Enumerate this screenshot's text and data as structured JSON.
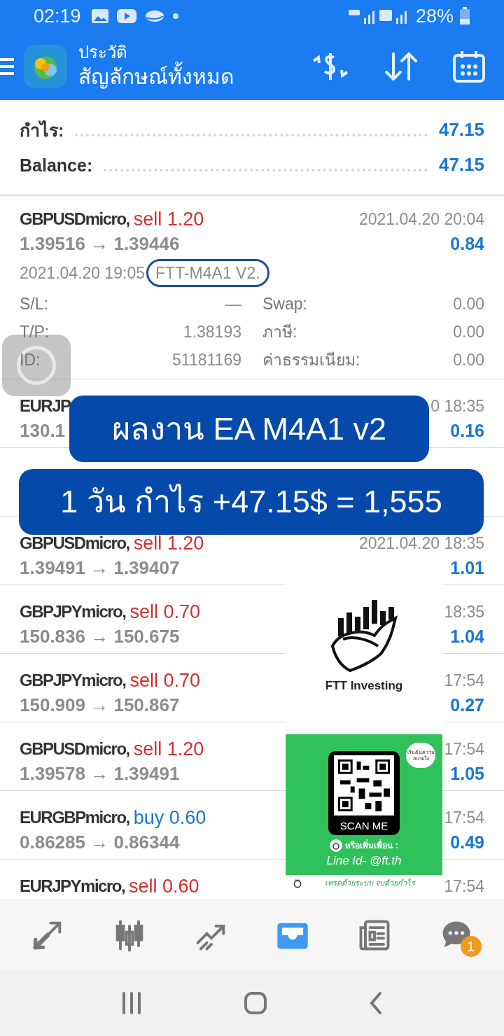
{
  "status_bar": {
    "time": "02:19",
    "battery": "28%"
  },
  "header": {
    "title": "ประวัติ",
    "subtitle": "สัญลักษณ์ทั้งหมด"
  },
  "summary": [
    {
      "label": "กำไร:",
      "value": "47.15"
    },
    {
      "label": "Balance:",
      "value": "47.15"
    }
  ],
  "trades": [
    {
      "symbol": "GBPUSDmicro,",
      "side": "sell 1.20",
      "kind": "sell",
      "prices": "1.39516 → 1.39446",
      "time": "2021.04.20 20:04",
      "profit": "0.84",
      "expanded": true,
      "open_time": "2021.04.20 19:05",
      "comment": "FTT-M4A1 V2.",
      "details": [
        {
          "label": "S/L:",
          "value": "—"
        },
        {
          "label": "Swap:",
          "value": "0.00"
        },
        {
          "label": "T/P:",
          "value": "1.38193"
        },
        {
          "label": "ภาษี:",
          "value": "0.00"
        },
        {
          "label": "ID:",
          "value": "51181169"
        },
        {
          "label": "ค่าธรรมเนียม:",
          "value": "0.00"
        }
      ]
    },
    {
      "symbol": "EURJP",
      "prices": "130.1",
      "time": "0 18:35",
      "profit": "0.16",
      "expanded": false
    },
    {
      "expanded": false
    },
    {
      "symbol": "GBPUSDmicro,",
      "side": "sell 1.20",
      "kind": "sell",
      "prices": "1.39491 → 1.39407",
      "time": "2021.04.20 18:35",
      "profit": "1.01",
      "expanded": false
    },
    {
      "symbol": "GBPJPYmicro,",
      "side": "sell 0.70",
      "kind": "sell",
      "prices": "150.836 → 150.675",
      "time": "18:35",
      "profit": "1.04",
      "expanded": false
    },
    {
      "symbol": "GBPJPYmicro,",
      "side": "sell 0.70",
      "kind": "sell",
      "prices": "150.909 → 150.867",
      "time": "17:54",
      "profit": "0.27",
      "expanded": false
    },
    {
      "symbol": "GBPUSDmicro,",
      "side": "sell 1.20",
      "kind": "sell",
      "prices": "1.39578 → 1.39491",
      "time": "17:54",
      "profit": "1.05",
      "expanded": false
    },
    {
      "symbol": "EURGBPmicro,",
      "side": "buy 0.60",
      "kind": "buy",
      "prices": "0.86285 → 0.86344",
      "time": "17:54",
      "profit": "0.49",
      "expanded": false
    },
    {
      "symbol": "EURJPYmicro,",
      "side": "sell 0.60",
      "kind": "sell",
      "time": "17:54",
      "expanded": false
    }
  ],
  "banners": [
    "ผลงาน EA M4A1 v2",
    "1 วัน กำไร +47.15$ = 1,555"
  ],
  "promo": {
    "brand": "FTT Investing",
    "bubble": "เริ่มต้นความสบายใจ",
    "scan": "SCAN ME",
    "add_friend": "หรือเพิ่มเพื่อน :",
    "line_id": "Line Id- @ft.th",
    "slogan": "เทรดด้วยระบบ จบด้วยกำไร"
  },
  "bottom_nav": [
    {
      "selected": false
    },
    {
      "selected": false
    },
    {
      "selected": false
    },
    {
      "selected": true
    },
    {
      "selected": false
    },
    {
      "selected": false,
      "badge": "1"
    }
  ]
}
